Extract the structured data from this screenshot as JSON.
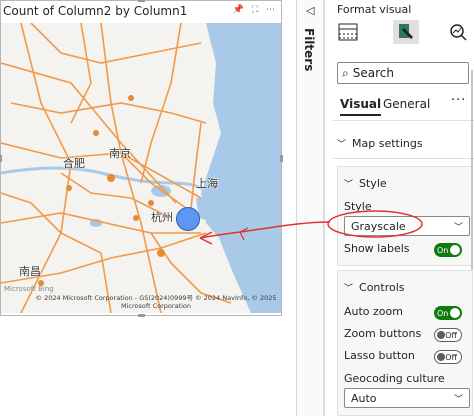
{
  "visual": {
    "title": "Count of Column2 by Column1",
    "toolbar_icons": [
      "pin-icon",
      "focus-icon",
      "more-options-icon"
    ],
    "cities": [
      {
        "name": "合肥"
      },
      {
        "name": "南京"
      },
      {
        "name": "上海"
      },
      {
        "name": "杭州"
      },
      {
        "name": "南昌"
      }
    ],
    "logo_text": "Microsoft Bing",
    "copyright": "© 2024 Microsoft Corporation - GS(2024)0999号 © 2024 NavInfo, © 2025 Microsoft Corporation",
    "bubble_color": "#4285f4",
    "road_color": "#f2994a"
  },
  "filters": {
    "label": "Filters",
    "toggle_icon": "collapse-left-icon"
  },
  "format_pane": {
    "title": "Format visual",
    "tabs": [
      {
        "icon": "build-visual-icon"
      },
      {
        "icon": "format-visual-icon",
        "selected": true
      },
      {
        "icon": "analytics-icon"
      }
    ],
    "search_placeholder": "Search",
    "subtabs": {
      "visual": "Visual",
      "general": "General"
    },
    "more": "···",
    "map_settings": "Map settings",
    "style_card": {
      "header": "Style",
      "style_label": "Style",
      "style_value": "Grayscale",
      "show_labels_label": "Show labels",
      "show_labels_state": "On"
    },
    "controls_card": {
      "header": "Controls",
      "auto_zoom_label": "Auto zoom",
      "auto_zoom_state": "On",
      "zoom_buttons_label": "Zoom buttons",
      "zoom_buttons_state": "Off",
      "lasso_button_label": "Lasso button",
      "lasso_button_state": "Off",
      "geocoding_label": "Geocoding culture",
      "geocoding_value": "Auto"
    },
    "toggle_on_color": "#107c10"
  },
  "annotation_color": "#e03131"
}
